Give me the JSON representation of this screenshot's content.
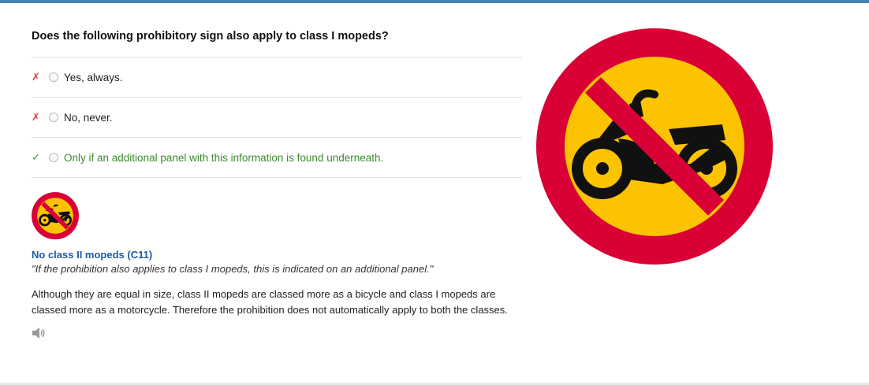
{
  "question": "Does the following prohibitory sign also apply to class I mopeds?",
  "answers": [
    {
      "mark": "✗",
      "text": "Yes, always.",
      "correct": false
    },
    {
      "mark": "✗",
      "text": "No, never.",
      "correct": false
    },
    {
      "mark": "✓",
      "text": "Only if an additional panel with this information is found underneath.",
      "correct": true
    }
  ],
  "explanation": {
    "sign_title": "No class II mopeds (C11)",
    "sign_quote": "\"If the prohibition also applies to class I mopeds, this is indicated on an additional panel.\"",
    "body": "Although they are equal in size, class II mopeds are classed more as a bicycle and class I mopeds are classed more as a motorcycle. Therefore the prohibition does not automatically apply to both the classes."
  },
  "icons": {
    "sign": "no-mopeds-sign-icon",
    "speaker": "speaker-icon"
  },
  "colors": {
    "top_bar": "#4a7fae",
    "sign_red": "#d90036",
    "sign_yellow": "#fcc400",
    "title_blue": "#1e5aa6",
    "correct_green": "#3a8a2a",
    "wrong_red": "#e04040"
  }
}
